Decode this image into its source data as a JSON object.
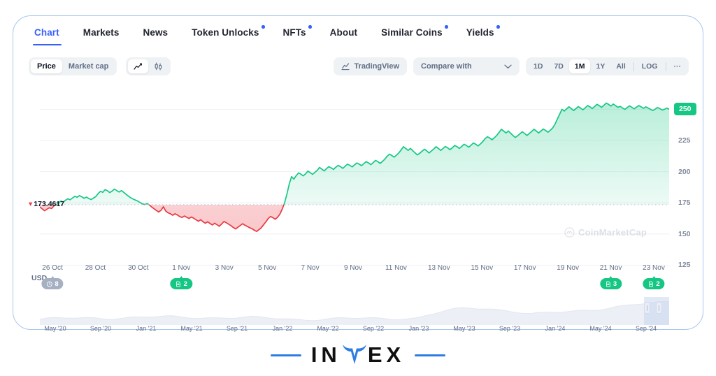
{
  "tabs": [
    {
      "label": "Chart",
      "active": true,
      "dot": false
    },
    {
      "label": "Markets",
      "active": false,
      "dot": false
    },
    {
      "label": "News",
      "active": false,
      "dot": false
    },
    {
      "label": "Token Unlocks",
      "active": false,
      "dot": true
    },
    {
      "label": "NFTs",
      "active": false,
      "dot": true
    },
    {
      "label": "About",
      "active": false,
      "dot": false
    },
    {
      "label": "Similar Coins",
      "active": false,
      "dot": true
    },
    {
      "label": "Yields",
      "active": false,
      "dot": true
    }
  ],
  "toolbar": {
    "metric_options": [
      {
        "label": "Price",
        "active": true
      },
      {
        "label": "Market cap",
        "active": false
      }
    ],
    "chart_type_icons": [
      {
        "name": "line-chart-icon",
        "active": true
      },
      {
        "name": "candlestick-chart-icon",
        "active": false
      }
    ],
    "tradingview_label": "TradingView",
    "compare_placeholder": "Compare with",
    "ranges": [
      {
        "label": "1D",
        "active": false
      },
      {
        "label": "7D",
        "active": false
      },
      {
        "label": "1M",
        "active": true
      },
      {
        "label": "1Y",
        "active": false
      },
      {
        "label": "All",
        "active": false
      }
    ],
    "log_label": "LOG",
    "more_label": "···"
  },
  "watermark": "CoinMarketCap",
  "logo": {
    "part1": "IN",
    "part2": "EX"
  },
  "colors": {
    "accent_blue": "#3861fb",
    "up_green": "#16c784",
    "down_red": "#ea3943",
    "axis_text": "#616e85",
    "card_border": "#a8c6ef"
  },
  "chart_data": {
    "type": "area",
    "title": "",
    "xlabel": "",
    "ylabel": "USD",
    "currency": "USD",
    "baseline_value": 173.4617,
    "baseline_label": "173.4617",
    "current_price_label": "250",
    "ylim": [
      105,
      262
    ],
    "yticks": [
      250,
      225,
      200,
      175,
      150,
      125
    ],
    "grid": true,
    "xticks": [
      "26 Oct",
      "28 Oct",
      "30 Oct",
      "1 Nov",
      "3 Nov",
      "5 Nov",
      "7 Nov",
      "9 Nov",
      "11 Nov",
      "13 Nov",
      "15 Nov",
      "17 Nov",
      "19 Nov",
      "21 Nov",
      "23 Nov"
    ],
    "event_badges": [
      {
        "x_label": "26 Oct",
        "count": "8",
        "icon": "clock-icon",
        "color": "gray"
      },
      {
        "x_label": "1 Nov",
        "count": "2",
        "icon": "document-icon",
        "color": "green"
      },
      {
        "x_label": "21 Nov",
        "count": "3",
        "icon": "document-icon",
        "color": "green"
      },
      {
        "x_label": "23 Nov",
        "count": "2",
        "icon": "document-icon",
        "color": "green"
      }
    ],
    "series": [
      {
        "name": "Price",
        "values": [
          171.5,
          170.2,
          168.6,
          169.8,
          171.0,
          170.4,
          172.4,
          173.4,
          175.0,
          176.4,
          175.6,
          177.0,
          178.2,
          177.4,
          178.8,
          180.2,
          179.4,
          180.8,
          179.8,
          178.6,
          179.6,
          178.4,
          177.6,
          178.8,
          180.0,
          182.4,
          184.2,
          183.4,
          185.6,
          184.6,
          183.2,
          184.4,
          186.0,
          184.8,
          183.6,
          184.8,
          183.4,
          181.8,
          180.4,
          179.0,
          178.0,
          177.2,
          176.4,
          175.2,
          174.2,
          173.6,
          174.4,
          173.2,
          171.6,
          170.2,
          168.8,
          167.6,
          169.0,
          171.8,
          168.4,
          167.0,
          166.2,
          165.0,
          166.2,
          165.2,
          164.0,
          163.2,
          164.4,
          163.4,
          162.4,
          163.6,
          162.6,
          161.4,
          160.2,
          161.4,
          159.8,
          158.6,
          159.8,
          158.4,
          157.2,
          158.6,
          157.4,
          156.2,
          158.0,
          160.0,
          159.0,
          157.8,
          156.6,
          155.2,
          154.0,
          155.4,
          156.8,
          158.2,
          157.0,
          156.0,
          155.0,
          154.2,
          153.0,
          152.0,
          153.4,
          155.0,
          157.4,
          159.8,
          162.4,
          164.0,
          163.0,
          161.8,
          163.4,
          166.0,
          170.0,
          175.0,
          182.0,
          190.0,
          196.0,
          194.0,
          196.8,
          199.0,
          198.0,
          196.6,
          198.2,
          200.4,
          199.2,
          197.8,
          199.4,
          201.0,
          203.4,
          202.0,
          200.6,
          202.4,
          204.0,
          203.0,
          201.8,
          203.6,
          205.0,
          204.0,
          202.6,
          204.4,
          206.0,
          205.0,
          203.8,
          205.4,
          207.0,
          206.0,
          204.8,
          206.4,
          208.0,
          207.0,
          205.6,
          207.2,
          209.0,
          208.0,
          206.6,
          208.2,
          210.0,
          212.4,
          214.0,
          213.0,
          211.6,
          213.2,
          215.0,
          217.4,
          220.0,
          218.6,
          217.0,
          218.6,
          216.8,
          215.0,
          213.4,
          214.8,
          216.4,
          218.0,
          216.6,
          215.0,
          216.6,
          218.2,
          220.0,
          218.6,
          217.0,
          218.6,
          220.2,
          219.0,
          217.6,
          219.2,
          221.0,
          220.0,
          218.6,
          220.2,
          222.0,
          221.0,
          219.6,
          221.2,
          223.0,
          222.0,
          220.6,
          222.2,
          224.0,
          226.4,
          228.0,
          227.0,
          225.6,
          227.2,
          229.0,
          231.4,
          234.0,
          232.6,
          231.0,
          232.6,
          230.8,
          229.0,
          227.4,
          228.8,
          230.4,
          232.0,
          230.6,
          229.0,
          230.6,
          232.2,
          234.0,
          232.6,
          231.0,
          232.6,
          234.2,
          233.0,
          231.6,
          233.2,
          235.0,
          238.0,
          242.0,
          246.0,
          250.0,
          248.6,
          250.4,
          252.0,
          250.6,
          249.0,
          250.6,
          252.2,
          251.0,
          249.6,
          251.2,
          253.0,
          252.0,
          250.6,
          252.2,
          254.0,
          253.0,
          251.6,
          253.2,
          255.0,
          254.0,
          252.6,
          254.2,
          253.0,
          251.6,
          252.4,
          251.0,
          250.0,
          251.4,
          252.8,
          251.6,
          250.4,
          251.8,
          253.0,
          252.0,
          250.8,
          252.0,
          251.0,
          250.0,
          249.0,
          250.2,
          251.4,
          250.6,
          249.4,
          250.0,
          251.0,
          250.0
        ]
      }
    ],
    "navigator": {
      "xticks": [
        "May '20",
        "Sep '20",
        "Jan '21",
        "May '21",
        "Sep '21",
        "Jan '22",
        "May '22",
        "Sep '22",
        "Jan '23",
        "May '23",
        "Sep '23",
        "Jan '24",
        "May '24",
        "Sep '24"
      ],
      "selection_start_pct": 96.0,
      "selection_end_pct": 100.0
    }
  }
}
